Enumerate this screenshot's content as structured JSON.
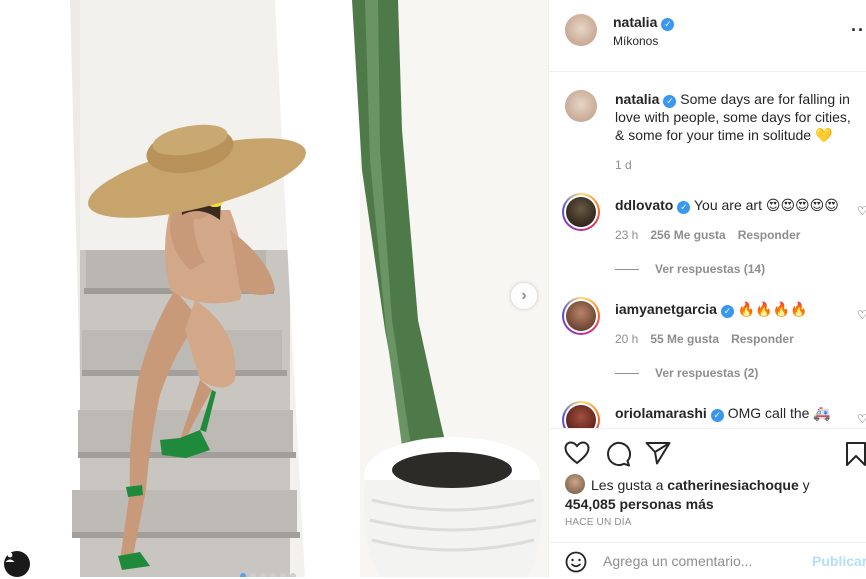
{
  "post": {
    "username": "natalia",
    "location": "Míkonos",
    "verified": true
  },
  "caption": {
    "username": "natalia",
    "text": "Some days are for falling in love with people, some days for cities, & some for your time in solitude 💛",
    "time": "1 d"
  },
  "comments": [
    {
      "username": "ddlovato",
      "text": "You are art 😍😍😍😍😍",
      "time": "23 h",
      "likes": "256 Me gusta",
      "reply_label": "Responder",
      "view_replies": "Ver respuestas (14)"
    },
    {
      "username": "iamyanetgarcia",
      "text": "🔥🔥🔥🔥",
      "time": "20 h",
      "likes": "55 Me gusta",
      "reply_label": "Responder",
      "view_replies": "Ver respuestas (2)"
    },
    {
      "username": "oriolamarashi",
      "text": "OMG call the 🚑"
    }
  ],
  "likes": {
    "prefix": "Les gusta a",
    "user": "catherinesiachoque",
    "connector": "y",
    "others": "454,085 personas más"
  },
  "timestamp": "Hace un día",
  "add_comment": {
    "placeholder": "Agrega un comentario...",
    "publish_label": "Publicar"
  },
  "icons": {
    "like": "heart-icon",
    "comment": "comment-icon",
    "share": "paper-plane-icon",
    "save": "bookmark-icon",
    "more": "more-options-icon",
    "next": "chevron-right-icon",
    "emoji": "smiley-icon"
  },
  "colors": {
    "verified": "#3897f0",
    "publish_disabled": "#b2dffc",
    "meta_gray": "#8e8e8e"
  },
  "carousel": {
    "count": 6,
    "active": 1
  }
}
